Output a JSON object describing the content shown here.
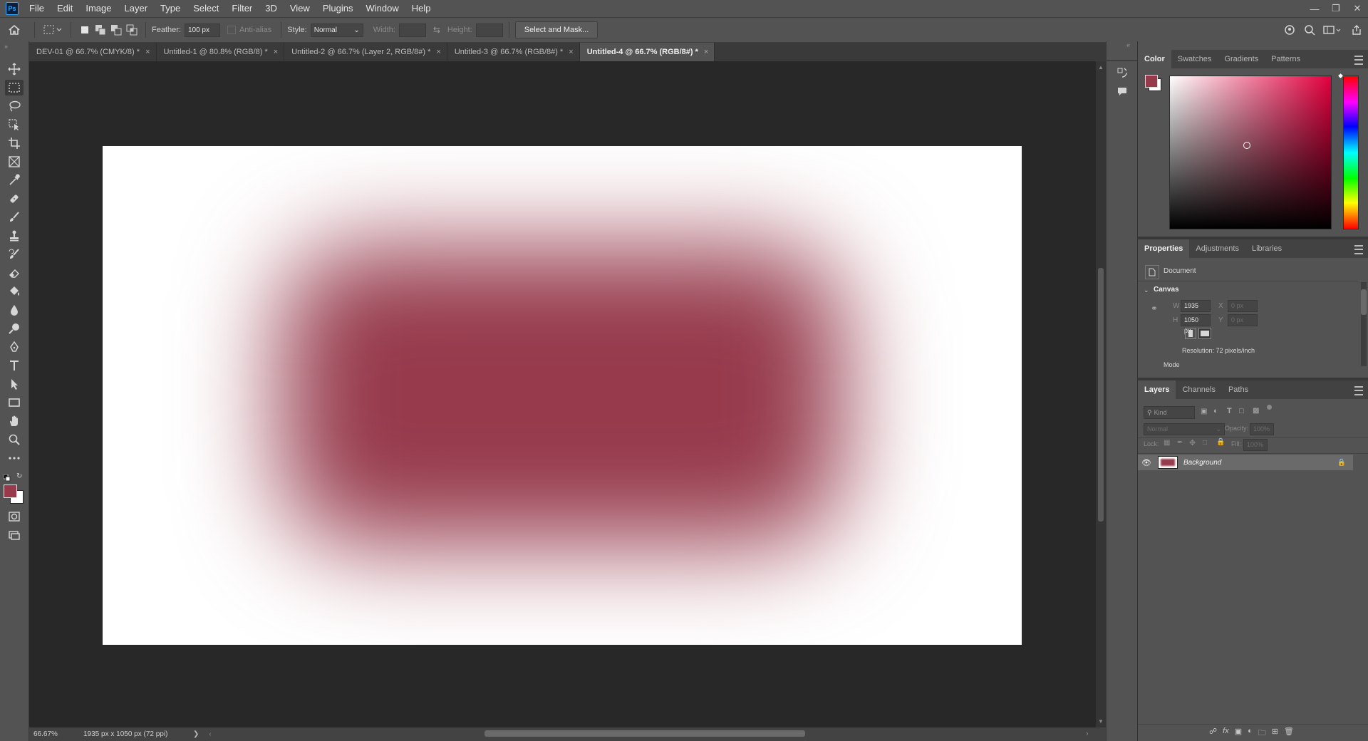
{
  "app": {
    "logo_text": "Ps"
  },
  "menu": [
    "File",
    "Edit",
    "Image",
    "Layer",
    "Type",
    "Select",
    "Filter",
    "3D",
    "View",
    "Plugins",
    "Window",
    "Help"
  ],
  "options": {
    "feather_label": "Feather:",
    "feather_value": "100 px",
    "antialias_label": "Anti-alias",
    "style_label": "Style:",
    "style_value": "Normal",
    "width_label": "Width:",
    "height_label": "Height:",
    "select_mask_label": "Select and Mask..."
  },
  "tabs": [
    {
      "label": "DEV-01 @ 66.7% (CMYK/8) *",
      "close": "×"
    },
    {
      "label": "Untitled-1 @ 80.8% (RGB/8) *",
      "close": "×"
    },
    {
      "label": "Untitled-2 @ 66.7% (Layer 2, RGB/8#) *",
      "close": "×"
    },
    {
      "label": "Untitled-3 @ 66.7% (RGB/8#) *",
      "close": "×"
    },
    {
      "label": "Untitled-4 @ 66.7% (RGB/8#) *",
      "close": "×"
    }
  ],
  "active_tab_index": 4,
  "canvas": {
    "fill_color": "#963a4c",
    "background": "#ffffff"
  },
  "status": {
    "zoom": "66.67%",
    "doc_info": "1935 px x 1050 px (72 ppi)",
    "arrow": "❯"
  },
  "colors": {
    "foreground": "#963a4c",
    "background": "#ffffff",
    "accent": "#31a8ff"
  },
  "color_panel": {
    "tabs": [
      "Color",
      "Swatches",
      "Gradients",
      "Patterns"
    ]
  },
  "properties_panel": {
    "tabs": [
      "Properties",
      "Adjustments",
      "Libraries"
    ],
    "doc_label": "Document",
    "section": "Canvas",
    "w_label": "W",
    "w_value": "1935 px",
    "h_label": "H",
    "h_value": "1050 px",
    "x_label": "X",
    "x_value": "0 px",
    "y_label": "Y",
    "y_value": "0 px",
    "resolution": "Resolution: 72 pixels/inch",
    "mode_label": "Mode"
  },
  "layers_panel": {
    "tabs": [
      "Layers",
      "Channels",
      "Paths"
    ],
    "kind_placeholder": "Kind",
    "blend_mode": "Normal",
    "opacity_label": "Opacity:",
    "opacity_value": "100%",
    "lock_label": "Lock:",
    "fill_label": "Fill:",
    "fill_value": "100%",
    "layers": [
      {
        "name": "Background",
        "visible": true,
        "locked": true
      }
    ]
  }
}
